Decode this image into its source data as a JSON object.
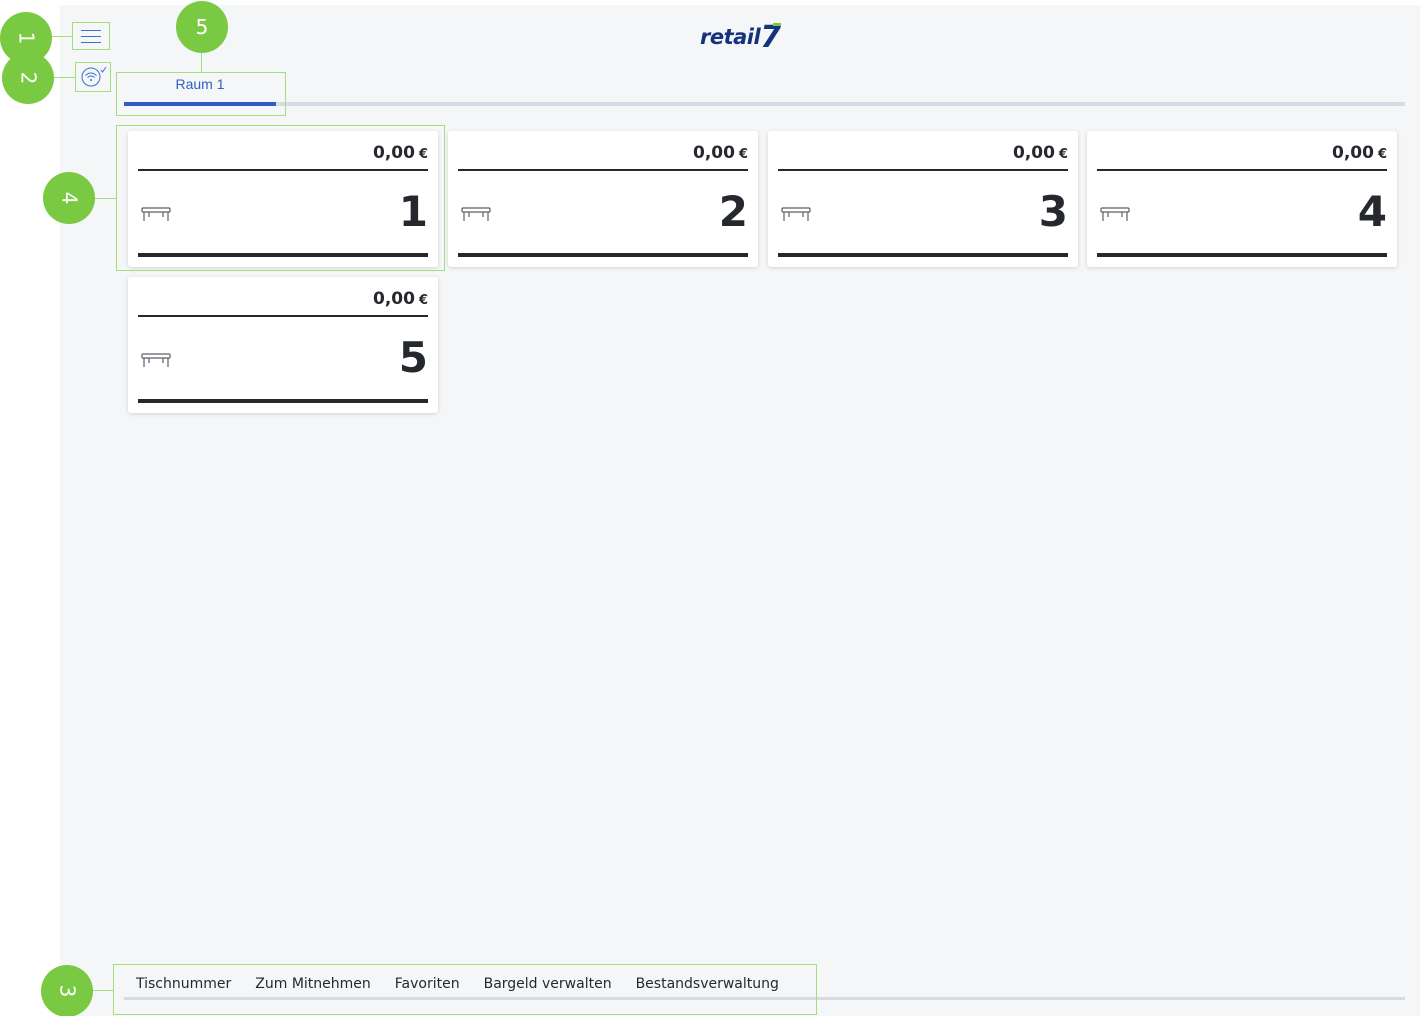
{
  "header": {
    "logo_text": "retail",
    "logo_number": "7",
    "brand_color": "#15337c",
    "accent_color": "#7ac943"
  },
  "menu_icon": "hamburger-menu-icon",
  "connection_icon": "wifi-connected-icon",
  "room_tabs": [
    {
      "label": "Raum 1",
      "active": true
    }
  ],
  "tables": [
    {
      "amount": "0,00",
      "currency": "€",
      "number": "1"
    },
    {
      "amount": "0,00",
      "currency": "€",
      "number": "2"
    },
    {
      "amount": "0,00",
      "currency": "€",
      "number": "3"
    },
    {
      "amount": "0,00",
      "currency": "€",
      "number": "4"
    },
    {
      "amount": "0,00",
      "currency": "€",
      "number": "5"
    }
  ],
  "bottom_nav": [
    {
      "label": "Tischnummer"
    },
    {
      "label": "Zum Mitnehmen"
    },
    {
      "label": "Favoriten"
    },
    {
      "label": "Bargeld verwalten"
    },
    {
      "label": "Bestandsverwaltung"
    }
  ],
  "callouts": [
    "1",
    "2",
    "3",
    "4",
    "5"
  ]
}
